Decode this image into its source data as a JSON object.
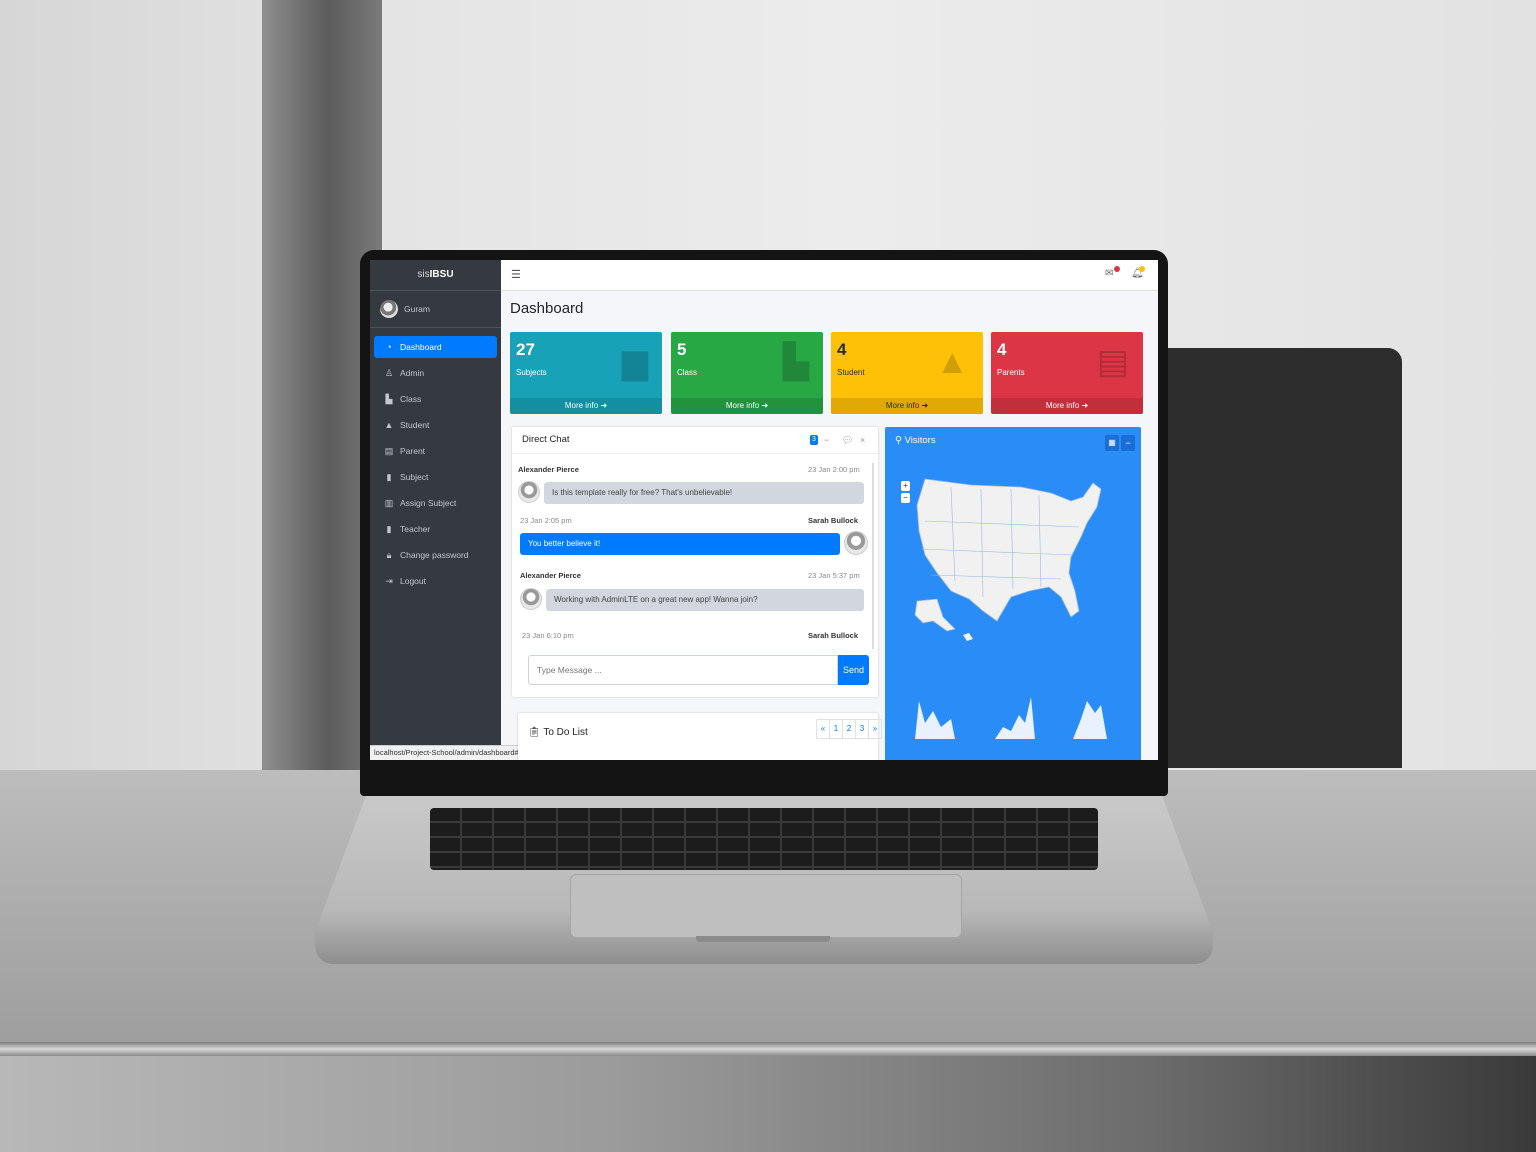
{
  "sidebar": {
    "brand_prefix": "sis",
    "brand_bold": "IBSU",
    "user_name": "Guram",
    "items": [
      {
        "label": "Dashboard",
        "icon": "dashboard-icon",
        "active": true
      },
      {
        "label": "Admin",
        "icon": "user-icon"
      },
      {
        "label": "Class",
        "icon": "door-icon"
      },
      {
        "label": "Student",
        "icon": "graduation-cap-icon"
      },
      {
        "label": "Parent",
        "icon": "id-card-icon"
      },
      {
        "label": "Subject",
        "icon": "book-icon"
      },
      {
        "label": "Assign Subject",
        "icon": "trash-icon"
      },
      {
        "label": "Teacher",
        "icon": "book-icon"
      },
      {
        "label": "Change password",
        "icon": "lock-icon"
      },
      {
        "label": "Logout",
        "icon": "sign-out-icon"
      }
    ]
  },
  "status_bar": {
    "url": "localhost/Project-School/admin/dashboard#"
  },
  "page": {
    "title": "Dashboard"
  },
  "stats": [
    {
      "count": "27",
      "label": "Subjects",
      "footer": "More info",
      "color": "#17a2b8",
      "icon": "book-icon"
    },
    {
      "count": "5",
      "label": "Class",
      "footer": "More info",
      "color": "#28a745",
      "icon": "door-icon"
    },
    {
      "count": "4",
      "label": "Student",
      "footer": "More info",
      "color": "#ffc107",
      "icon": "graduation-cap-icon"
    },
    {
      "count": "4",
      "label": "Parents",
      "footer": "More info",
      "color": "#dc3545",
      "icon": "id-card-icon"
    }
  ],
  "chat": {
    "title": "Direct Chat",
    "badge": "3",
    "messages": [
      {
        "name": "Alexander Pierce",
        "time": "23 Jan 2:00 pm",
        "text": "Is this template really for free? That's unbelievable!",
        "side": "left"
      },
      {
        "name": "Sarah Bullock",
        "time": "23 Jan 2:05 pm",
        "text": "You better believe it!",
        "side": "right"
      },
      {
        "name": "Alexander Pierce",
        "time": "23 Jan 5:37 pm",
        "text": "Working with AdminLTE on a great new app! Wanna join?",
        "side": "left"
      },
      {
        "name": "Sarah Bullock",
        "time": "23 Jan 6:10 pm",
        "text": "",
        "side": "right"
      }
    ],
    "input_placeholder": "Type Message ...",
    "send_label": "Send"
  },
  "todo": {
    "title": "To Do List",
    "pages": [
      "«",
      "1",
      "2",
      "3",
      "»"
    ]
  },
  "visitors": {
    "title": "Visitors",
    "zoom_in": "+",
    "zoom_out": "−"
  },
  "colors": {
    "accent": "#007bff",
    "sidebar": "#343a40",
    "visitors_bg": "#2a8cf6"
  }
}
